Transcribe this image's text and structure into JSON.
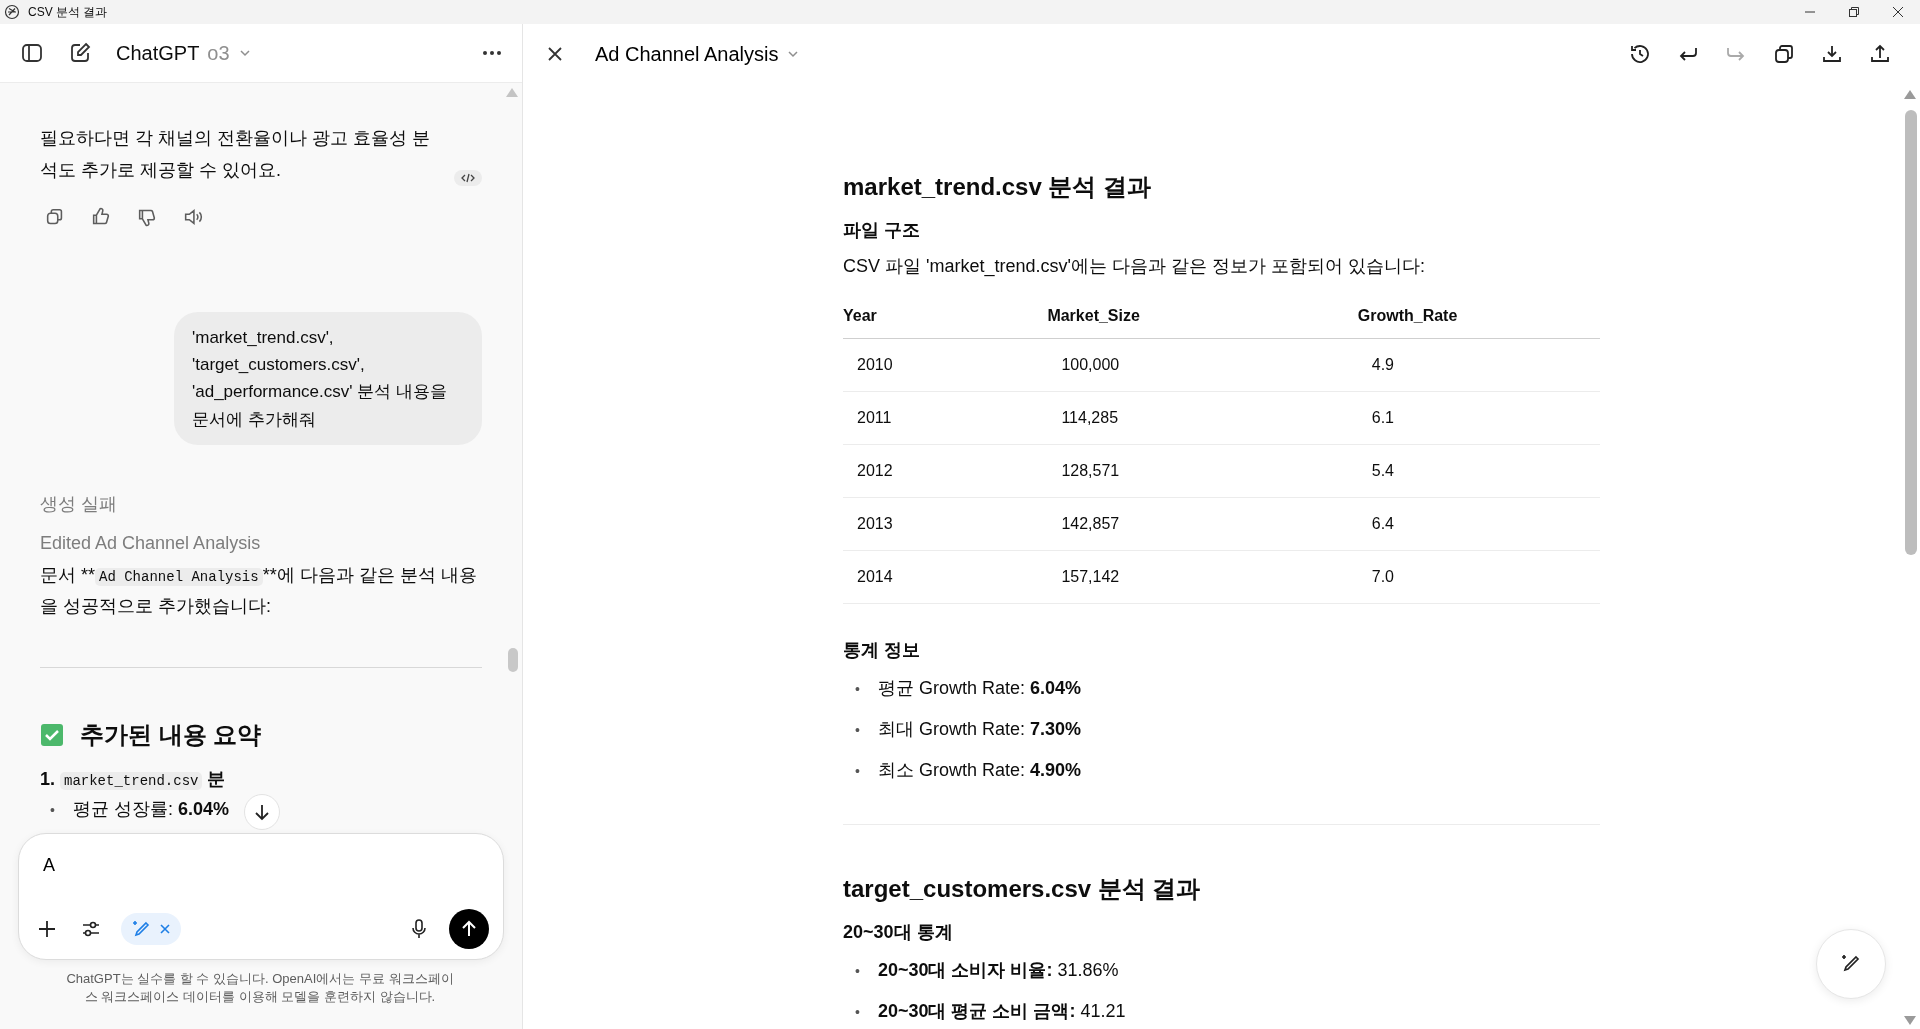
{
  "window": {
    "title": "CSV 분석 결과"
  },
  "chat": {
    "title": "ChatGPT",
    "model": "o3",
    "reply_text": "필요하다면 각 채널의 전환율이나 광고 효율성 분석도 추가로 제공할 수 있어요.",
    "user_message": "'market_trend.csv', 'target_customers.csv', 'ad_performance.csv' 분석 내용을 문서에 추가해줘",
    "status": "생성 실패",
    "edit_note": "Edited Ad Channel Analysis",
    "result": {
      "prefix": "문서 **",
      "code": "Ad Channel Analysis",
      "suffix": "**에 다음과 같은 분석 내용을 성공적으로 추가했습니다:"
    },
    "summary_heading": "추가된 내용 요약",
    "summary_item": {
      "number": "1.",
      "code": "market_trend.csv",
      "text": "분"
    },
    "summary_bullet": {
      "marker": "•",
      "text": "평균 성장률: **6.04%**"
    },
    "composer": {
      "value": "A"
    },
    "disclaimer": "ChatGPT는 실수를 할 수 있습니다. OpenAI에서는 무료 워크스페이스 워크스페이스 데이터를 이용해 모델을 훈련하지 않습니다."
  },
  "canvas": {
    "title": "Ad Channel Analysis",
    "blocks": [
      {
        "kind": "h2",
        "text": "market_trend.csv 분석 결과"
      },
      {
        "kind": "h3",
        "text": "파일 구조"
      },
      {
        "kind": "p",
        "text": "CSV 파일 'market_trend.csv'에는 다음과 같은 정보가 포함되어 있습니다:"
      },
      {
        "kind": "table",
        "columns": [
          "Year",
          "Market_Size",
          "Growth_Rate"
        ],
        "rows": [
          [
            "2010",
            "100,000",
            "4.9"
          ],
          [
            "2011",
            "114,285",
            "6.1"
          ],
          [
            "2012",
            "128,571",
            "5.4"
          ],
          [
            "2013",
            "142,857",
            "6.4"
          ],
          [
            "2014",
            "157,142",
            "7.0"
          ]
        ]
      },
      {
        "kind": "h3",
        "text": "통계 정보"
      },
      {
        "kind": "ul",
        "marker": "•",
        "items": [
          "평균 Growth Rate: **6.04%**",
          "최대 Growth Rate: **7.30%**",
          "최소 Growth Rate: **4.90%**"
        ]
      },
      {
        "kind": "hr"
      },
      {
        "kind": "h2",
        "text": "target_customers.csv 분석 결과"
      },
      {
        "kind": "h3",
        "text": "20~30대 통계"
      },
      {
        "kind": "ul",
        "marker": "•",
        "items": [
          "**20~30대 소비자 비율:** 31.86%",
          "**20~30대 평균 소비 금액:** 41.21"
        ]
      }
    ]
  }
}
